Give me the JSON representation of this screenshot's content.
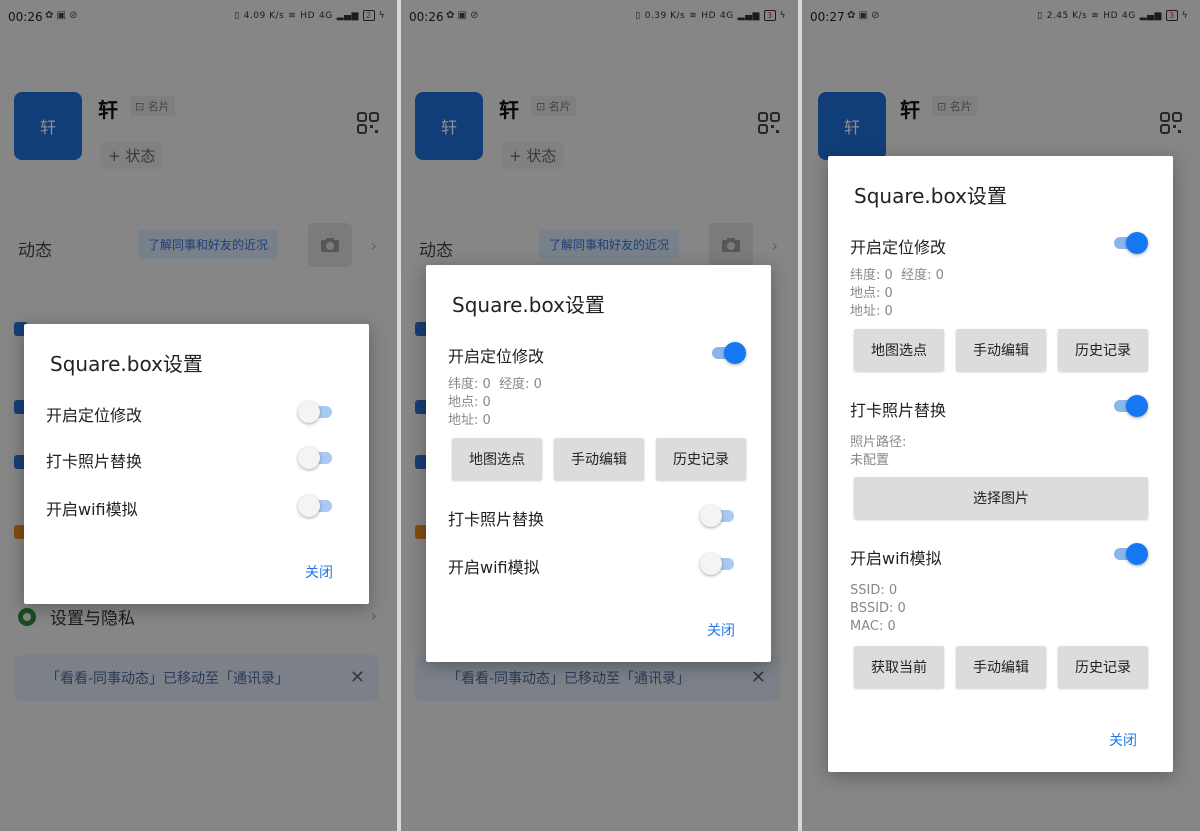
{
  "status_bar": [
    {
      "time": "00:26",
      "net": "4.09 K/s",
      "network": "4G",
      "hd": "HD",
      "battery": "2"
    },
    {
      "time": "00:26",
      "net": "0.39 K/s",
      "network": "4G",
      "hd": "HD",
      "battery": "3"
    },
    {
      "time": "00:27",
      "net": "2.45 K/s",
      "network": "4G",
      "hd": "HD",
      "battery": "3"
    }
  ],
  "profile": {
    "avatar_text": "轩",
    "name": "轩",
    "card_label": "名片",
    "add_status": "+ 状态"
  },
  "feed": {
    "label": "动态",
    "tip": "了解同事和好友的近况"
  },
  "menu": {
    "settings_privacy": "设置与隐私"
  },
  "notice": {
    "text": "「看看-同事动态」已移动至「通讯录」",
    "close": "✕"
  },
  "dialog": {
    "title": "Square.box设置",
    "location_toggle": "开启定位修改",
    "photo_toggle": "打卡照片替换",
    "wifi_toggle": "开启wifi模拟",
    "close": "关闭",
    "lat_label": "纬度:",
    "lat_value": "0",
    "lng_label": "经度:",
    "lng_value": "0",
    "place_label": "地点:",
    "place_value": "0",
    "address_label": "地址:",
    "address_value": "0",
    "map_pick": "地图选点",
    "manual_edit": "手动编辑",
    "history": "历史记录",
    "photo_path_label": "照片路径:",
    "photo_path_value": "未配置",
    "choose_image": "选择图片",
    "ssid": "SSID: 0",
    "bssid": "BSSID: 0",
    "mac": "MAC: 0",
    "get_current": "获取当前"
  },
  "toggles": {
    "screen1": {
      "location": false,
      "photo": false,
      "wifi": false
    },
    "screen2": {
      "location": true,
      "photo": false,
      "wifi": false
    },
    "screen3": {
      "location": true,
      "photo": true,
      "wifi": true
    }
  },
  "colors": {
    "accent": "#1677f2",
    "avatar": "#1f6fd6",
    "close_text": "#1f7ae6",
    "overlay": "rgba(0,0,0,0.44)"
  }
}
